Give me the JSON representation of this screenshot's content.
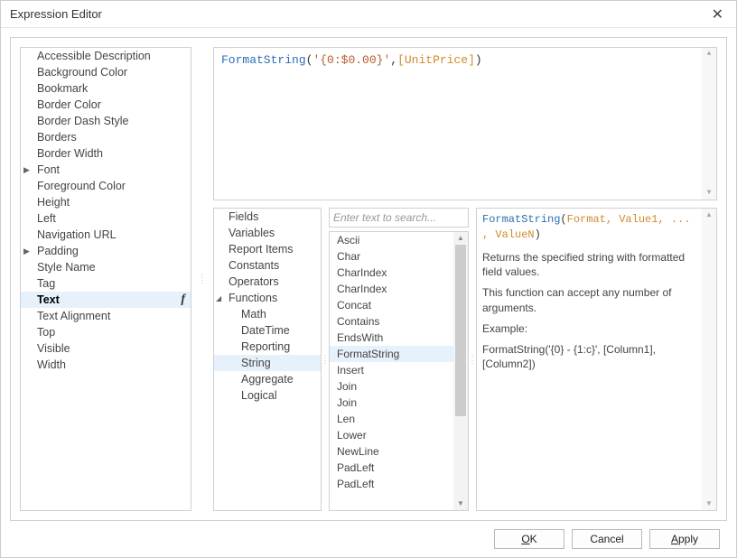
{
  "dialog": {
    "title": "Expression Editor"
  },
  "properties": {
    "selected": "Text",
    "items": [
      {
        "label": "Accessible Description",
        "expandable": false
      },
      {
        "label": "Background Color",
        "expandable": false
      },
      {
        "label": "Bookmark",
        "expandable": false
      },
      {
        "label": "Border Color",
        "expandable": false
      },
      {
        "label": "Border Dash Style",
        "expandable": false
      },
      {
        "label": "Borders",
        "expandable": false
      },
      {
        "label": "Border Width",
        "expandable": false
      },
      {
        "label": "Font",
        "expandable": true
      },
      {
        "label": "Foreground Color",
        "expandable": false
      },
      {
        "label": "Height",
        "expandable": false
      },
      {
        "label": "Left",
        "expandable": false
      },
      {
        "label": "Navigation URL",
        "expandable": false
      },
      {
        "label": "Padding",
        "expandable": true
      },
      {
        "label": "Style Name",
        "expandable": false
      },
      {
        "label": "Tag",
        "expandable": false
      },
      {
        "label": "Text",
        "expandable": false,
        "selected": true,
        "hasFx": true
      },
      {
        "label": "Text Alignment",
        "expandable": false
      },
      {
        "label": "Top",
        "expandable": false
      },
      {
        "label": "Visible",
        "expandable": false
      },
      {
        "label": "Width",
        "expandable": false
      }
    ]
  },
  "expression": {
    "func": "FormatString",
    "literal": "'{0:$0.00}'",
    "field": "[UnitPrice]"
  },
  "categories": {
    "selected": "String",
    "items": [
      {
        "label": "Fields",
        "level": 0
      },
      {
        "label": "Variables",
        "level": 0
      },
      {
        "label": "Report Items",
        "level": 0
      },
      {
        "label": "Constants",
        "level": 0
      },
      {
        "label": "Operators",
        "level": 0
      },
      {
        "label": "Functions",
        "level": 0,
        "expanded": true
      },
      {
        "label": "Math",
        "level": 1
      },
      {
        "label": "DateTime",
        "level": 1
      },
      {
        "label": "Reporting",
        "level": 1
      },
      {
        "label": "String",
        "level": 1,
        "selected": true
      },
      {
        "label": "Aggregate",
        "level": 1
      },
      {
        "label": "Logical",
        "level": 1
      }
    ]
  },
  "search": {
    "placeholder": "Enter text to search..."
  },
  "functions": {
    "selected": "FormatString",
    "items": [
      "Ascii",
      "Char",
      "CharIndex",
      "CharIndex",
      "Concat",
      "Contains",
      "EndsWith",
      "FormatString",
      "Insert",
      "Join",
      "Join",
      "Len",
      "Lower",
      "NewLine",
      "PadLeft",
      "PadLeft"
    ]
  },
  "help": {
    "signature": {
      "name": "FormatString",
      "args": "Format, Value1, ... , ValueN"
    },
    "descLine1": "Returns the specified string with formatted field values.",
    "descLine2": "This function can accept any number of arguments.",
    "exampleLabel": "Example:",
    "exampleText": "FormatString('{0} - {1:c}', [Column1], [Column2])"
  },
  "buttons": {
    "ok": "OK",
    "cancel": "Cancel",
    "apply": "Apply"
  }
}
